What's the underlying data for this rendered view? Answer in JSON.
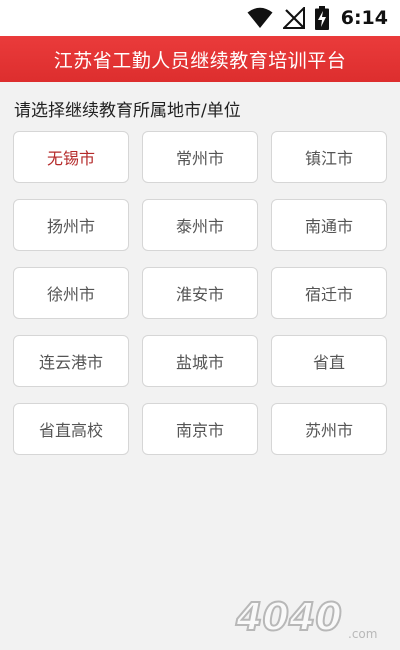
{
  "status_bar": {
    "time": "6:14",
    "icons": [
      "wifi-icon",
      "signal-off-icon",
      "battery-charging-icon"
    ]
  },
  "app_bar": {
    "title": "江苏省工勤人员继续教育培训平台",
    "color": "#e53535"
  },
  "prompt": "请选择继续教育所属地市/单位",
  "selected_city": "无锡市",
  "selected_color": "#b42a2a",
  "cities": [
    {
      "label": "无锡市"
    },
    {
      "label": "常州市"
    },
    {
      "label": "镇江市"
    },
    {
      "label": "扬州市"
    },
    {
      "label": "泰州市"
    },
    {
      "label": "南通市"
    },
    {
      "label": "徐州市"
    },
    {
      "label": "淮安市"
    },
    {
      "label": "宿迁市"
    },
    {
      "label": "连云港市"
    },
    {
      "label": "盐城市"
    },
    {
      "label": "省直"
    },
    {
      "label": "省直高校"
    },
    {
      "label": "南京市"
    },
    {
      "label": "苏州市"
    }
  ],
  "watermark": {
    "text": "4040",
    "suffix": ".com"
  }
}
